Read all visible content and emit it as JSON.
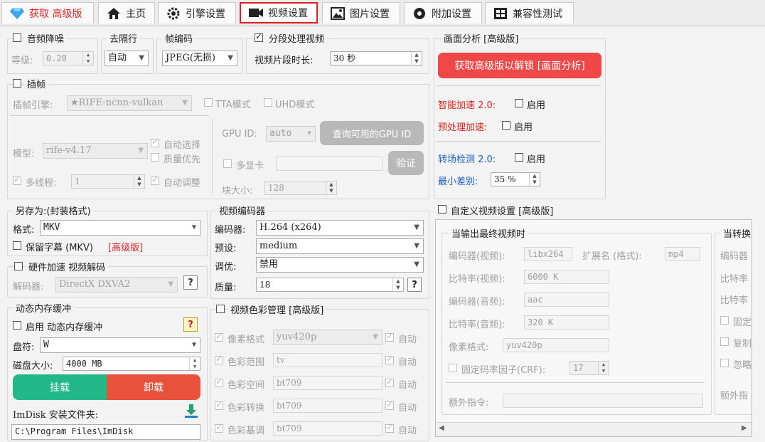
{
  "tabs": [
    {
      "label": "获取 高级版",
      "icon": "diamond-icon"
    },
    {
      "label": "主页",
      "icon": "home-icon"
    },
    {
      "label": "引擎设置",
      "icon": "engine-gear-icon"
    },
    {
      "label": "视频设置",
      "icon": "video-icon"
    },
    {
      "label": "图片设置",
      "icon": "image-icon"
    },
    {
      "label": "附加设置",
      "icon": "gear-icon"
    },
    {
      "label": "兼容性测试",
      "icon": "grid-icon"
    }
  ],
  "audio": {
    "denoise_label": "音频降噪",
    "level_label": "等级:",
    "level_value": "0.20"
  },
  "deinterlace": {
    "label": "去隔行",
    "value": "自动"
  },
  "frame_codec": {
    "label": "帧编码",
    "value": "JPEG(无损)"
  },
  "segment": {
    "label": "分段处理视频",
    "length_label": "视频片段时长:",
    "length_value": "30 秒"
  },
  "interp": {
    "label": "插帧",
    "engine_label": "插帧引擎:",
    "engine_value": "★RIFE-ncnn-vulkan",
    "tta_label": "TTA模式",
    "uhd_label": "UHD模式",
    "model_label": "模型:",
    "model_value": "rife-v4.17",
    "auto_select": "自动选择",
    "quality_first": "质量优先",
    "multithread_label": "多线程:",
    "multithread_value": "1",
    "auto_adjust": "自动调整",
    "gpu_label": "GPU ID:",
    "gpu_value": "auto",
    "query_gpu": "查询可用的GPU ID",
    "multi_gpu": "多显卡",
    "verify": "验证",
    "block_label": "块大小:",
    "block_value": "128"
  },
  "analysis": {
    "title": "画面分析 [高级版]",
    "unlock": "获取高级版以解锁 [画面分析]",
    "smart_accel": "智能加速 2.0:",
    "pre_accel": "预处理加速:",
    "enable": "启用",
    "scene_detect": "转场检测 2.0:",
    "min_diff": "最小差别:",
    "min_diff_value": "35 %"
  },
  "save_as": {
    "title": "另存为:(封装格式)",
    "format_label": "格式:",
    "format_value": "MKV",
    "keep_subs": "保留字幕 (MKV)",
    "pro": "[高级版]"
  },
  "hw_decode": {
    "title": "硬件加速 视频解码",
    "decoder_label": "解码器:",
    "decoder_value": "DirectX DXVA2"
  },
  "dyn_mem": {
    "title": "动态内存缓冲",
    "enable_label": "启用 动态内存缓冲",
    "drive_label": "盘符:",
    "drive_value": "W",
    "size_label": "磁盘大小:",
    "size_value": "4000 MB",
    "mount": "挂载",
    "unmount": "卸载",
    "folder_label": "ImDisk 安装文件夹:",
    "folder_value": "C:\\Program Files\\ImDisk"
  },
  "video_encoder": {
    "title": "视频编码器",
    "encoder_label": "编码器:",
    "encoder_value": "H.264 (x264)",
    "preset_label": "预设:",
    "preset_value": "medium",
    "tune_label": "调优:",
    "tune_value": "禁用",
    "quality_label": "质量:",
    "quality_value": "18"
  },
  "color": {
    "title": "视频色彩管理 [高级版]",
    "auto": "自动",
    "rows": [
      {
        "label": "像素格式",
        "value": "yuv420p"
      },
      {
        "label": "色彩范围",
        "value": "tv"
      },
      {
        "label": "色彩空间",
        "value": "bt709"
      },
      {
        "label": "色彩转换",
        "value": "bt709"
      },
      {
        "label": "色彩基调",
        "value": "bt709"
      }
    ]
  },
  "custom": {
    "title": "自定义视频设置 [高级版]",
    "group_final": "当输出最终视频时",
    "group_right": "当转换",
    "vcodec_label": "编码器(视频):",
    "vcodec_value": "libx264",
    "ext_label": "扩展名 (格式):",
    "ext_value": "mp4",
    "vbitrate_label": "比特率(视频):",
    "vbitrate_value": "6000 K",
    "acodec_label": "编码器(音频):",
    "acodec_value": "aac",
    "abitrate_label": "比特率(音频):",
    "abitrate_value": "320 K",
    "pixfmt_label": "像素格式:",
    "pixfmt_value": "yuv420p",
    "crf_label": "固定码率因子(CRF):",
    "crf_value": "17",
    "extra_label": "额外指令:",
    "right_enc": "编码器",
    "right_bit1": "比特率",
    "right_bit2": "比特率",
    "right_fixed": "固定",
    "right_copy": "复制",
    "right_ignore": "忽略",
    "right_extra": "额外指"
  },
  "colors": {
    "red_button": "#f04848",
    "green_button": "#22b888",
    "accent_red": "#e02020",
    "accent_blue": "#1a5cc8"
  }
}
